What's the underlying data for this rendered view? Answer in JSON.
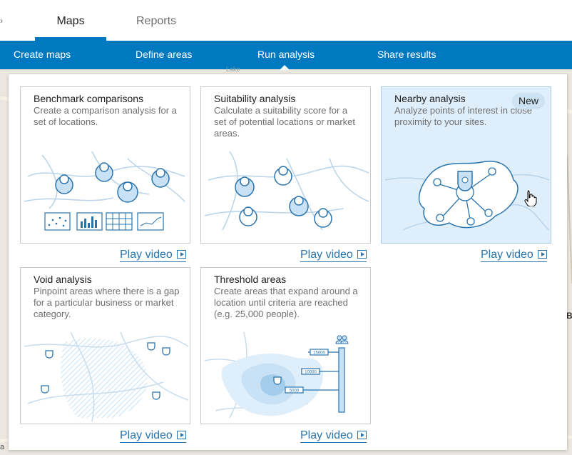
{
  "top_tabs": [
    {
      "label": "Maps",
      "active": true
    },
    {
      "label": "Reports",
      "active": false
    }
  ],
  "nav": {
    "items": [
      "Create maps",
      "Define areas",
      "Run analysis",
      "Share results"
    ],
    "active": "Run analysis"
  },
  "map": {
    "place_label": "Lake",
    "edge_letter_right": "B",
    "edge_letter_bottom": "a"
  },
  "cards": [
    {
      "title": "Benchmark comparisons",
      "desc": "Create a comparison analysis for a set of locations.",
      "play": "Play video",
      "icon": "benchmark-illustration"
    },
    {
      "title": "Suitability analysis",
      "desc": "Calculate a suitability score for a set of potential locations or market areas.",
      "play": "Play video",
      "icon": "suitability-illustration"
    },
    {
      "title": "Nearby analysis",
      "desc": "Analyze points of interest in close proximity to your sites.",
      "play": "Play video",
      "badge": "New",
      "selected": true,
      "icon": "nearby-illustration"
    },
    {
      "title": "Void analysis",
      "desc": "Pinpoint areas where there is a gap for a particular business or market category.",
      "play": "Play video",
      "icon": "void-illustration"
    },
    {
      "title": "Threshold areas",
      "desc": "Create areas that expand around a location until criteria are reached (e.g. 25,000 people).",
      "play": "Play video",
      "icon": "threshold-illustration",
      "threshold_labels": [
        "15000",
        "10000",
        "5000"
      ]
    }
  ],
  "colors": {
    "brand_blue": "#0079c1",
    "illustration_blue": "#2a74ad",
    "selected_card": "#deeefa"
  }
}
